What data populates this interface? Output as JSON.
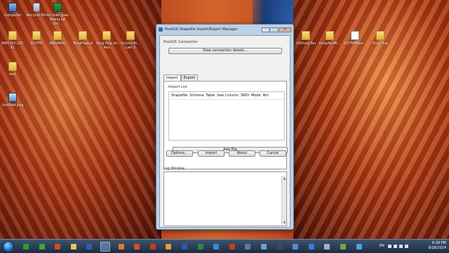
{
  "desktop": {
    "icons": [
      {
        "label": "Computer",
        "kind": "pc"
      },
      {
        "label": "Recycle Bin",
        "kind": "bin"
      },
      {
        "label": "An toàn giao thông tài chi...",
        "kind": "xls"
      },
      {
        "label": "BAN DO LOC XL",
        "kind": "folder"
      },
      {
        "label": "DLHTR",
        "kind": "folder"
      },
      {
        "label": "ANGIANG",
        "kind": "folder"
      },
      {
        "label": "TongHopLai",
        "kind": "folder"
      },
      {
        "label": "Tong Hop du lieu",
        "kind": "folder"
      },
      {
        "label": "DuLieuTo... Lan 3",
        "kind": "folder"
      },
      {
        "label": "test",
        "kind": "folder"
      },
      {
        "label": "Untitled.png",
        "kind": "img"
      },
      {
        "label": "XQVungTau",
        "kind": "folder"
      },
      {
        "label": "VungTauMi...",
        "kind": "folder"
      },
      {
        "label": "XQTNMBpe...",
        "kind": "doc"
      },
      {
        "label": "Tong Hop",
        "kind": "folder"
      }
    ]
  },
  "dialog": {
    "title": "PostGIS Shapefile Import/Export Manager",
    "window_buttons": {
      "minimize": "–",
      "maximize": "□",
      "close": "✕"
    },
    "connection_group": "PostGIS Connection",
    "view_connection_button": "View connection details...",
    "tabs": [
      {
        "label": "Import",
        "active": true
      },
      {
        "label": "Export",
        "active": false
      }
    ],
    "import_list_label": "Import List",
    "columns": [
      "Shapefile",
      "Schema",
      "Table",
      "Geo Column",
      "SRID",
      "Mode",
      "Rm"
    ],
    "add_file_button": "Add File",
    "buttons": {
      "options": "Options...",
      "import": "Import",
      "about": "About",
      "cancel": "Cancel"
    },
    "log_window_label": "Log Window"
  },
  "taskbar": {
    "lang": "EN",
    "time": "6:39 PM",
    "date": "9/28/2014",
    "apps": [
      {
        "name": "chrome-like-app",
        "color": "#2e9b3a",
        "active": false
      },
      {
        "name": "coccoc-app",
        "color": "#3fa63f",
        "active": false
      },
      {
        "name": "mapinfo-app",
        "color": "#d24a2a",
        "active": false
      },
      {
        "name": "explorer-app",
        "color": "#f1c24a",
        "active": false
      },
      {
        "name": "word-app",
        "color": "#2d5db8",
        "active": false
      },
      {
        "name": "postgis-app",
        "color": "#4a7ab8",
        "active": true
      },
      {
        "name": "media-app",
        "color": "#e07a2a",
        "active": false
      },
      {
        "name": "winamp-app",
        "color": "#d84a2a",
        "active": false
      },
      {
        "name": "foxit-app",
        "color": "#c8382a",
        "active": false
      },
      {
        "name": "paint-app",
        "color": "#e0a02a",
        "active": false
      },
      {
        "name": "photoshop-app",
        "color": "#2a5ab0",
        "active": false
      },
      {
        "name": "excel-app",
        "color": "#2a8a3a",
        "active": false
      },
      {
        "name": "maps-app",
        "color": "#3a8ad0",
        "active": false
      },
      {
        "name": "filezilla-app",
        "color": "#c83a2a",
        "active": false
      },
      {
        "name": "pgadmin-app",
        "color": "#5a7aa8",
        "active": false
      },
      {
        "name": "notepad-app",
        "color": "#70a0d0",
        "active": false
      },
      {
        "name": "terminal-app",
        "color": "#404a58",
        "active": false
      },
      {
        "name": "viewer-app",
        "color": "#5a8ac8",
        "active": false
      },
      {
        "name": "ie-app",
        "color": "#3a7ad8",
        "active": false
      },
      {
        "name": "tool-app",
        "color": "#a8b0b8",
        "active": false
      },
      {
        "name": "qgis-app",
        "color": "#6aa84a",
        "active": false
      },
      {
        "name": "ie2-app",
        "color": "#4aa0e0",
        "active": false
      }
    ]
  }
}
